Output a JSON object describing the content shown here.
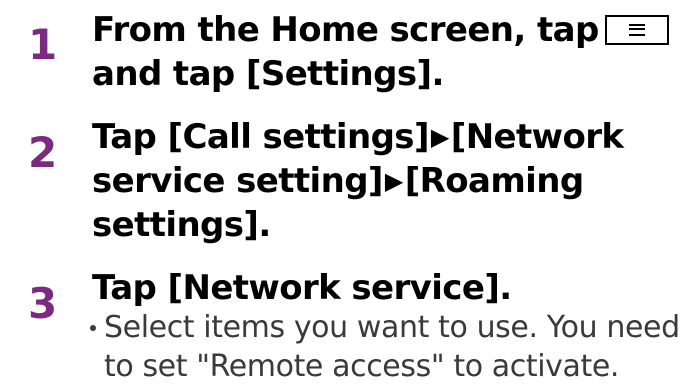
{
  "steps": [
    {
      "number": "1",
      "line1": "From the Home screen, tap",
      "icon": "menu-key-icon",
      "line2": "and tap [Settings]."
    },
    {
      "number": "2",
      "line1a": "Tap [Call settings]",
      "line1b": "[Network",
      "line2a": "service setting]",
      "line2b": "[Roaming",
      "line3": "settings].",
      "arrow_symbol": "▶"
    },
    {
      "number": "3",
      "line1": "Tap [Network service].",
      "bullet_line1": "Select items you want to use. You need",
      "bullet_line2": "to set \"Remote access\" to activate."
    }
  ],
  "colors": {
    "step_number": "#7b2a82",
    "heading_text": "#000000",
    "body_text": "#3a3a3a"
  }
}
